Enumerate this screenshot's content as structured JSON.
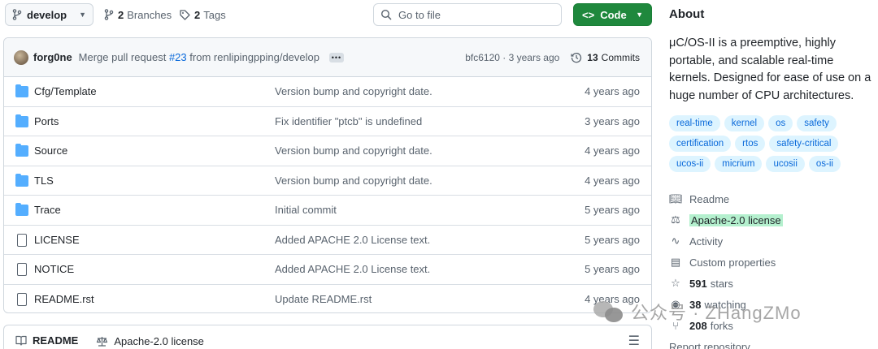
{
  "toolbar": {
    "branch": "develop",
    "branches_count": "2",
    "branches_label": "Branches",
    "tags_count": "2",
    "tags_label": "Tags",
    "search_placeholder": "Go to file",
    "code_label": "Code"
  },
  "commit": {
    "author": "forg0ne",
    "message_prefix": "Merge pull request ",
    "pr": "#23",
    "message_suffix": " from renlipingpping/develop",
    "sha_time": "bfc6120 · 3 years ago",
    "commits_count": "13",
    "commits_label": "Commits"
  },
  "files": [
    {
      "name": "Cfg/Template",
      "type": "folder",
      "message": "Version bump and copyright date.",
      "date": "4 years ago"
    },
    {
      "name": "Ports",
      "type": "folder",
      "message": "Fix identifier \"ptcb\" is undefined",
      "date": "3 years ago"
    },
    {
      "name": "Source",
      "type": "folder",
      "message": "Version bump and copyright date.",
      "date": "4 years ago"
    },
    {
      "name": "TLS",
      "type": "folder",
      "message": "Version bump and copyright date.",
      "date": "4 years ago"
    },
    {
      "name": "Trace",
      "type": "folder",
      "message": "Initial commit",
      "date": "5 years ago"
    },
    {
      "name": "LICENSE",
      "type": "file",
      "message": "Added APACHE 2.0 License text.",
      "date": "5 years ago"
    },
    {
      "name": "NOTICE",
      "type": "file",
      "message": "Added APACHE 2.0 License text.",
      "date": "5 years ago"
    },
    {
      "name": "README.rst",
      "type": "file",
      "message": "Update README.rst",
      "date": "4 years ago"
    }
  ],
  "readme_bar": {
    "readme_tab": "README",
    "license_tab": "Apache-2.0 license"
  },
  "about": {
    "title": "About",
    "description": "μC/OS-II is a preemptive, highly portable, and scalable real-time kernels. Designed for ease of use on a huge number of CPU architectures.",
    "topics": [
      "real-time",
      "kernel",
      "os",
      "safety",
      "certification",
      "rtos",
      "safety-critical",
      "ucos-ii",
      "micrium",
      "ucosii",
      "os-ii"
    ],
    "readme": "Readme",
    "license": "Apache-2.0 license",
    "activity": "Activity",
    "custom_properties": "Custom properties",
    "stars_count": "591",
    "stars_label": "stars",
    "watching_count": "38",
    "watching_label": "watching",
    "forks_count": "208",
    "forks_label": "forks",
    "report": "Report repository"
  },
  "watermark": "公众号 · ZHangZMo"
}
